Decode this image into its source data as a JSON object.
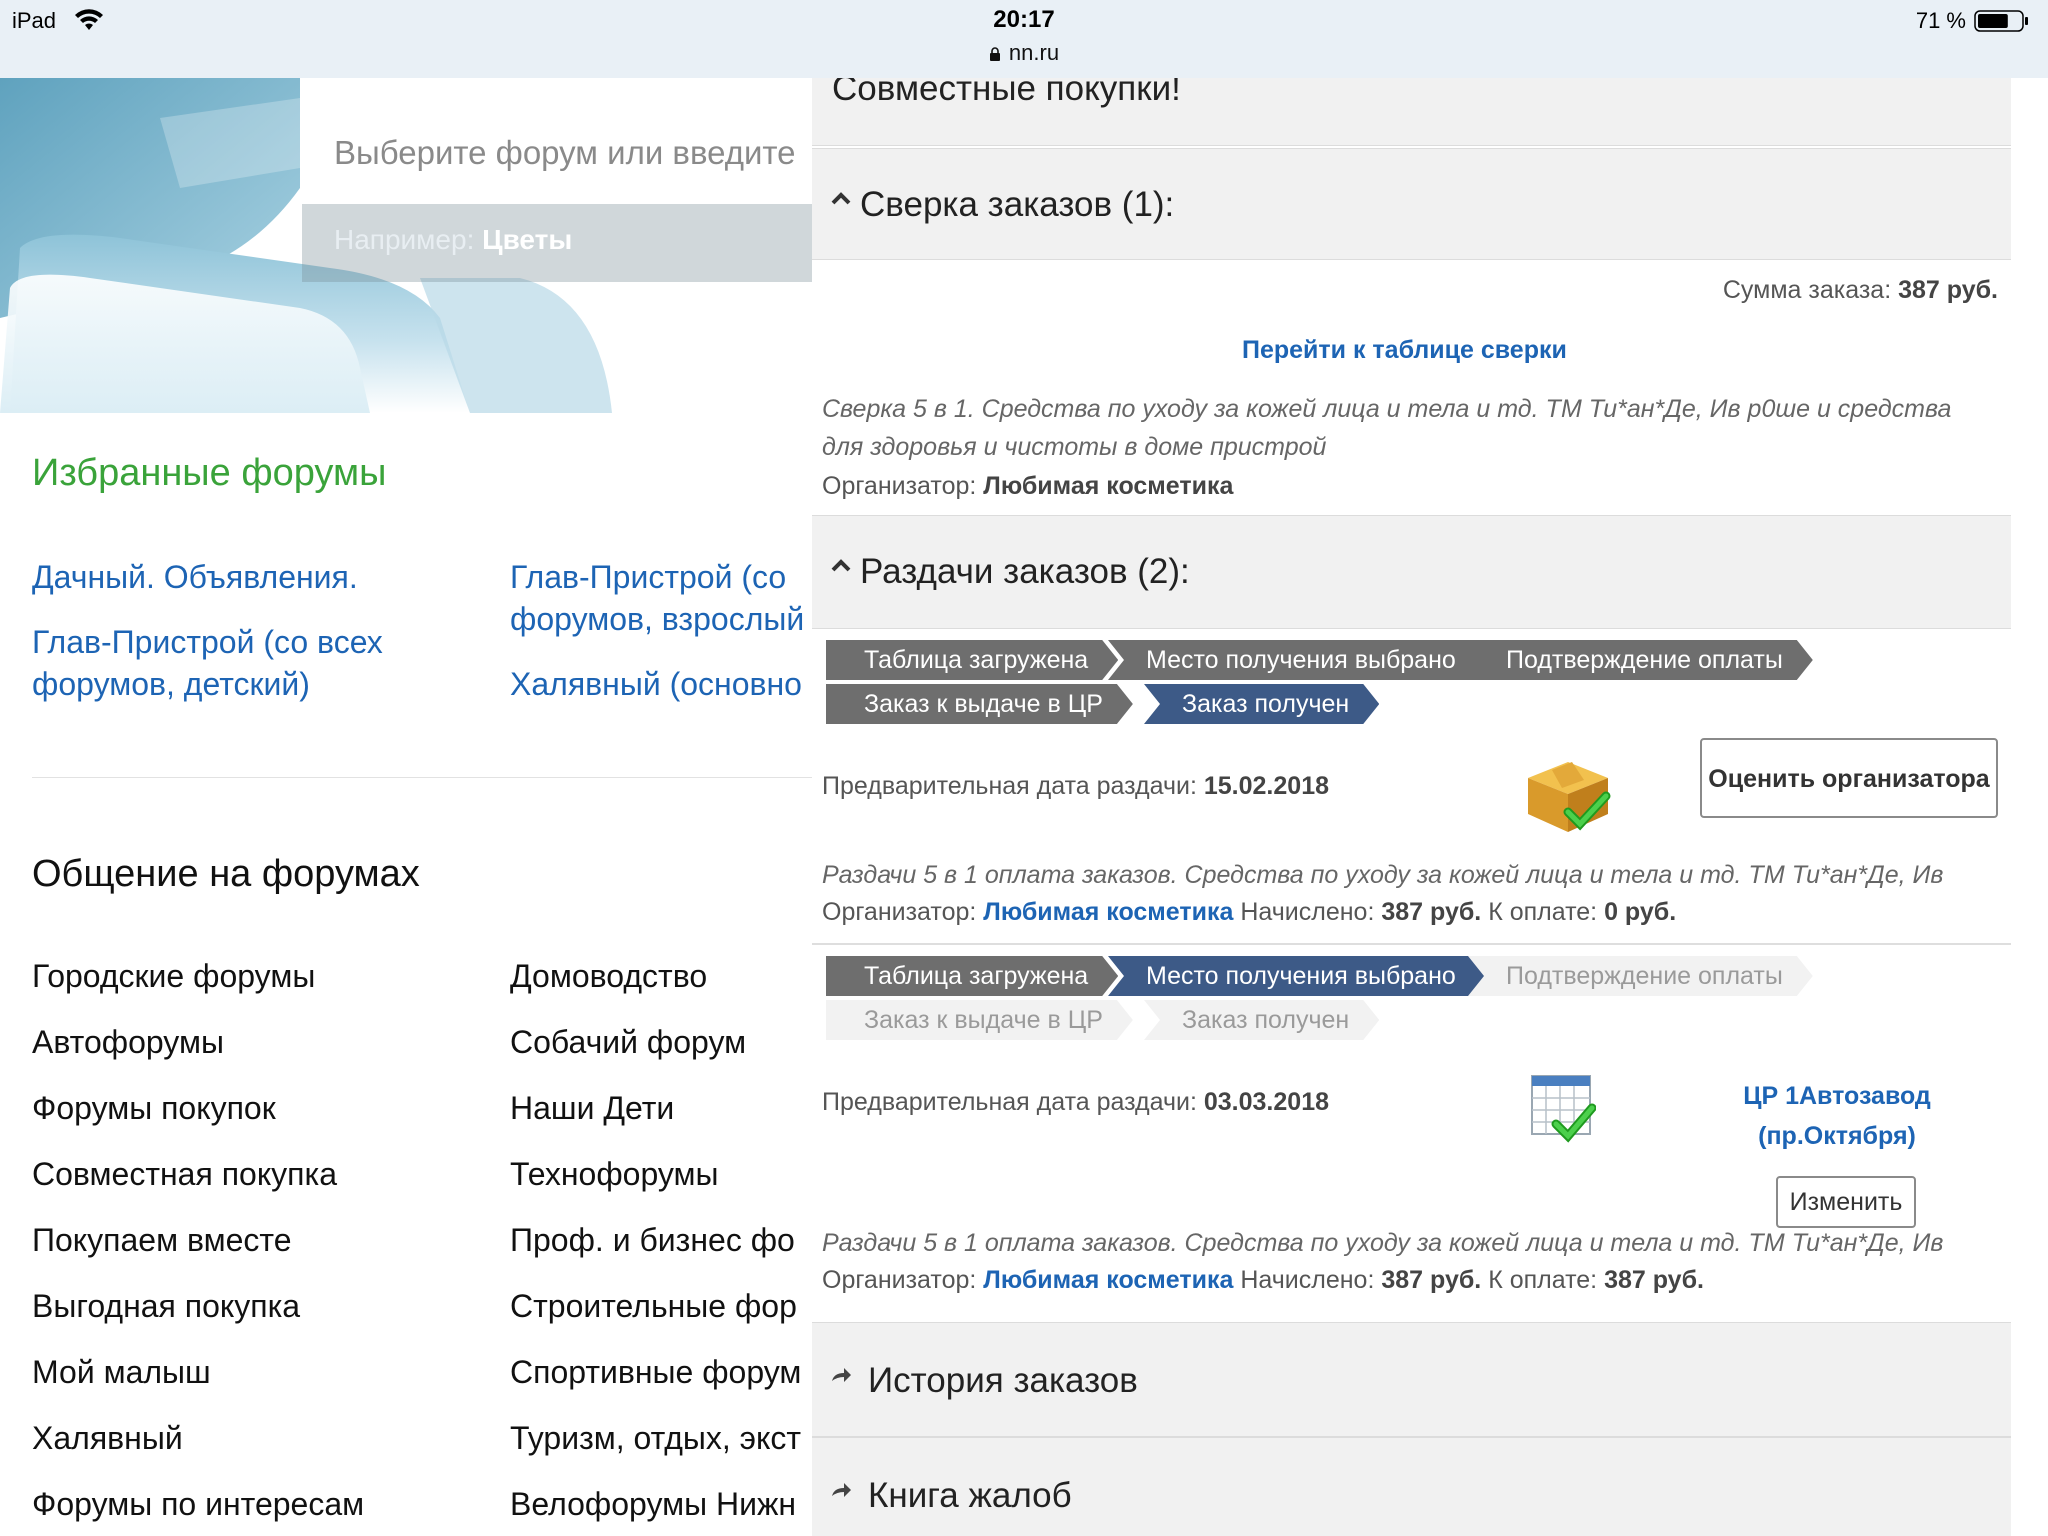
{
  "status_bar": {
    "device": "iPad",
    "time": "20:17",
    "url": "nn.ru",
    "battery": "71 %",
    "battery_level": 0.71,
    "wifi_icon": "wifi-icon",
    "lock_icon": "lock-icon",
    "battery_icon": "battery-icon"
  },
  "search": {
    "placeholder": "Выберите форум или введите",
    "hint_prefix": "Например:",
    "hint_value": "Цветы"
  },
  "favorites": {
    "title": "Избранные форумы",
    "links": [
      "Дачный. Объявления.",
      "Глав-Пристрой (со всех",
      "форумов, детский)",
      "Глав-Пристрой (со",
      "форумов, взрослый",
      "Халявный (основно"
    ]
  },
  "communication": {
    "title": "Общение на форумах",
    "left": [
      "Городские форумы",
      "Автофорумы",
      "Форумы покупок",
      "Совместная покупка",
      "Покупаем вместе",
      "Выгодная покупка",
      "Мой малыш",
      "Халявный",
      "Форумы по интересам"
    ],
    "right": [
      "Домоводство",
      "Собачий форум",
      "Наши Дети",
      "Технофорумы",
      "Проф. и бизнес фо",
      "Строительные фор",
      "Спортивные форум",
      "Туризм, отдых, экст",
      "Велофорумы Нижн"
    ]
  },
  "panel": {
    "top_title": "Совместные покупки!",
    "reconciliation": {
      "title": "Сверка заказов (1):",
      "sum_label": "Сумма заказа:",
      "sum_value": "387 руб.",
      "goto_link": "Перейти к таблице сверки",
      "desc_line1": "Сверка 5 в 1. Средства по уходу за кожей лица и тела и тд. ТМ Ти*ан*Де, Ив р0ше и средства",
      "desc_line2": "для здоровья и чистоты в доме пристрой",
      "org_label": "Организатор:",
      "org_value": "Любимая косметика"
    },
    "distributions": {
      "title": "Раздачи заказов (2):",
      "step_labels": [
        "Таблица загружена",
        "Место получения выбрано",
        "Подтверждение оплаты",
        "Заказ к выдаче в ЦР",
        "Заказ получен"
      ],
      "items": [
        {
          "date_label": "Предварительная дата раздачи:",
          "date_value": "15.02.2018",
          "action_label": "Оценить организатора",
          "desc": "Раздачи 5 в 1 оплата заказов. Средства по уходу за кожей лица и тела и тд. ТМ Ти*ан*Де, Ив",
          "org_label": "Организатор:",
          "org_value": "Любимая косметика",
          "accrued_label": "Начислено:",
          "accrued_value": "387 руб.",
          "topay_label": "К оплате:",
          "topay_value": "0 руб.",
          "icon": "box-check-icon"
        },
        {
          "date_label": "Предварительная дата раздачи:",
          "date_value": "03.03.2018",
          "pickup_line1": "ЦР 1Автозавод",
          "pickup_line2": "(пр.Октября)",
          "change_label": "Изменить",
          "desc": "Раздачи 5 в 1 оплата заказов. Средства по уходу за кожей лица и тела и тд. ТМ Ти*ан*Де, Ив",
          "org_label": "Организатор:",
          "org_value": "Любимая косметика",
          "accrued_label": "Начислено:",
          "accrued_value": "387 руб.",
          "topay_label": "К оплате:",
          "topay_value": "387 руб.",
          "icon": "calendar-check-icon"
        }
      ]
    },
    "history": {
      "title": "История заказов"
    },
    "complaints": {
      "title": "Книга жалоб"
    }
  },
  "colors": {
    "link_blue": "#1d64b4",
    "favorites_green": "#3aa33a",
    "step_done_grey": "#6e6e6e",
    "step_current_blue": "#3d5a87",
    "step_pending": "#f2f2f2"
  }
}
